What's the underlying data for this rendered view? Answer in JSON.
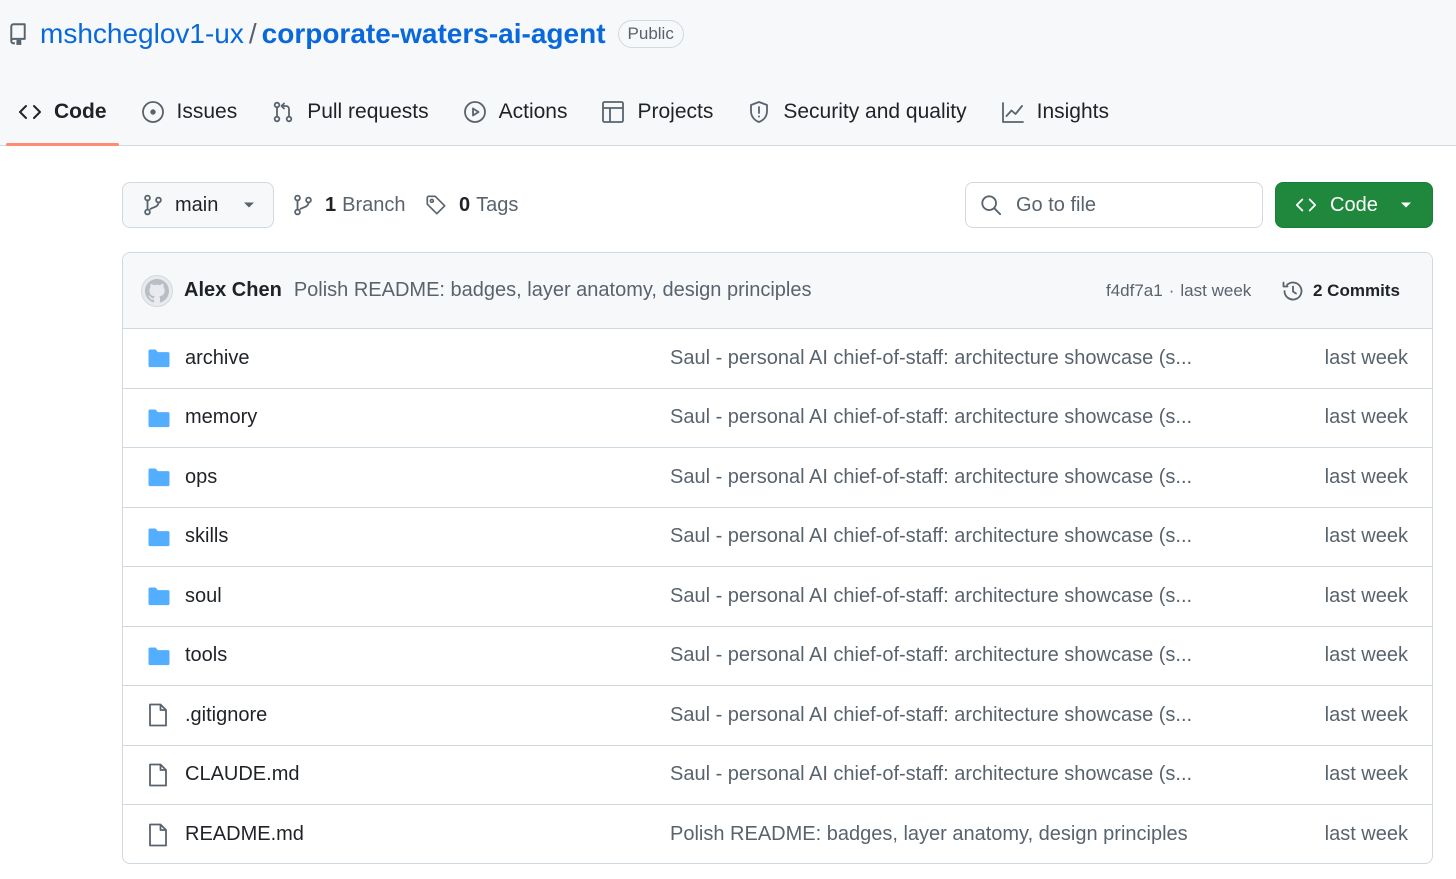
{
  "repo": {
    "owner": "mshcheglov1-ux",
    "separator": "/",
    "name": "corporate-waters-ai-agent",
    "visibility": "Public"
  },
  "tabs": [
    {
      "label": "Code",
      "icon": "code-icon",
      "selected": true
    },
    {
      "label": "Issues",
      "icon": "issue-opened-icon"
    },
    {
      "label": "Pull requests",
      "icon": "git-pull-request-icon"
    },
    {
      "label": "Actions",
      "icon": "play-icon"
    },
    {
      "label": "Projects",
      "icon": "table-icon"
    },
    {
      "label": "Security and quality",
      "icon": "shield-icon"
    },
    {
      "label": "Insights",
      "icon": "graph-icon"
    }
  ],
  "toolbar": {
    "branch": "main",
    "branch_count": "1",
    "branch_label": "Branch",
    "tag_count": "0",
    "tag_label": "Tags",
    "search_placeholder": "Go to file",
    "code_button": "Code"
  },
  "latest_commit": {
    "author": "Alex Chen",
    "message": "Polish README: badges, layer anatomy, design principles",
    "hash": "f4df7a1",
    "separator": "·",
    "time": "last week",
    "commits_label": "2 Commits"
  },
  "files": [
    {
      "name": "archive",
      "type": "dir",
      "message": "Saul - personal AI chief-of-staff: architecture showcase (s...",
      "date": "last week"
    },
    {
      "name": "memory",
      "type": "dir",
      "message": "Saul - personal AI chief-of-staff: architecture showcase (s...",
      "date": "last week"
    },
    {
      "name": "ops",
      "type": "dir",
      "message": "Saul - personal AI chief-of-staff: architecture showcase (s...",
      "date": "last week"
    },
    {
      "name": "skills",
      "type": "dir",
      "message": "Saul - personal AI chief-of-staff: architecture showcase (s...",
      "date": "last week"
    },
    {
      "name": "soul",
      "type": "dir",
      "message": "Saul - personal AI chief-of-staff: architecture showcase (s...",
      "date": "last week"
    },
    {
      "name": "tools",
      "type": "dir",
      "message": "Saul - personal AI chief-of-staff: architecture showcase (s...",
      "date": "last week"
    },
    {
      "name": ".gitignore",
      "type": "file",
      "message": "Saul - personal AI chief-of-staff: architecture showcase (s...",
      "date": "last week"
    },
    {
      "name": "CLAUDE.md",
      "type": "file",
      "message": "Saul - personal AI chief-of-staff: architecture showcase (s...",
      "date": "last week"
    },
    {
      "name": "README.md",
      "type": "file",
      "message": "Polish README: badges, layer anatomy, design principles",
      "date": "last week"
    }
  ],
  "colors": {
    "link": "#0969da",
    "folder": "#54aeff",
    "primary_button": "#1f883d",
    "tab_underline": "#fd8c73",
    "muted_text": "#59636e"
  }
}
